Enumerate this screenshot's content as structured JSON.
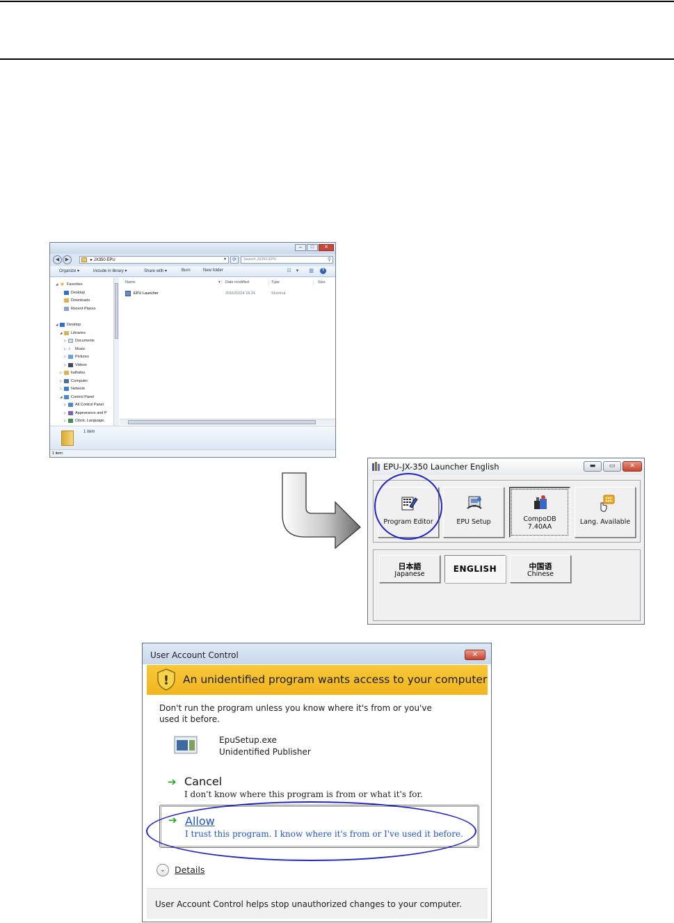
{
  "explorer": {
    "breadcrumb": "JX350 EPU",
    "search_placeholder": "Search JX350 EPU",
    "toolbar": {
      "organize": "Organize ▾",
      "include_in_library": "Include in library ▾",
      "share_with": "Share with ▾",
      "burn": "Burn",
      "new_folder": "New folder"
    },
    "nav_tree": [
      {
        "label": "Favorites",
        "icon": "star-icon"
      },
      {
        "label": "Desktop",
        "icon": "desktop-icon"
      },
      {
        "label": "Downloads",
        "icon": "downloads-icon"
      },
      {
        "label": "Recent Places",
        "icon": "recent-places-icon"
      },
      {
        "label": "Desktop",
        "icon": "desktop-icon"
      },
      {
        "label": "Libraries",
        "icon": "libraries-icon"
      },
      {
        "label": "Documents",
        "icon": "documents-icon"
      },
      {
        "label": "Music",
        "icon": "music-icon"
      },
      {
        "label": "Pictures",
        "icon": "pictures-icon"
      },
      {
        "label": "Videos",
        "icon": "videos-icon"
      },
      {
        "label": "kaihatsu",
        "icon": "user-folder-icon"
      },
      {
        "label": "Computer",
        "icon": "computer-icon"
      },
      {
        "label": "Network",
        "icon": "network-icon"
      },
      {
        "label": "Control Panel",
        "icon": "control-panel-icon"
      },
      {
        "label": "All Control Panel",
        "icon": "control-panel-icon"
      },
      {
        "label": "Appearance and P",
        "icon": "appearance-icon"
      },
      {
        "label": "Clock, Language,",
        "icon": "clock-icon"
      }
    ],
    "columns": {
      "name": "Name",
      "date_modified": "Date modified",
      "type": "Type",
      "size": "Size"
    },
    "files": [
      {
        "name": "EPU Launcher",
        "date_modified": "2015/02/24 18:24",
        "type": "Shortcut",
        "icon": "shortcut-icon"
      }
    ],
    "details_count": "1 item",
    "status": "1 item"
  },
  "launcher": {
    "title": "EPU-JX-350 Launcher   English",
    "buttons": [
      {
        "label": "Program Editor",
        "icon": "program-editor-icon"
      },
      {
        "label": "EPU Setup",
        "icon": "epu-setup-icon"
      },
      {
        "label": "CompoDB\n7.40AA",
        "icon": "compodb-icon"
      },
      {
        "label": "Lang. Available",
        "icon": "language-available-icon"
      }
    ],
    "lang_buttons": {
      "japanese_native": "日本語",
      "japanese": "Japanese",
      "english": "ENGLISH",
      "chinese_native": "中国语",
      "chinese": "Chinese"
    }
  },
  "uac": {
    "title": "User Account Control",
    "headline": "An unidentified program wants access to your computer",
    "warning": "Don't run the program unless you know where it's from or you've used it before.",
    "program": "EpuSetup.exe",
    "publisher": "Unidentified Publisher",
    "cancel_title": "Cancel",
    "cancel_desc": "I don't know where this program is from or what it's for.",
    "allow_title": "Allow",
    "allow_desc": "I trust this program. I know where it's from or I've used it before.",
    "details": "Details",
    "footer": "User Account Control helps stop unauthorized changes to your computer."
  },
  "colors": {
    "highlight_circle": "#1f22c9",
    "uac_banner": "#f4bc2b",
    "allow_link": "#1f55c5"
  }
}
